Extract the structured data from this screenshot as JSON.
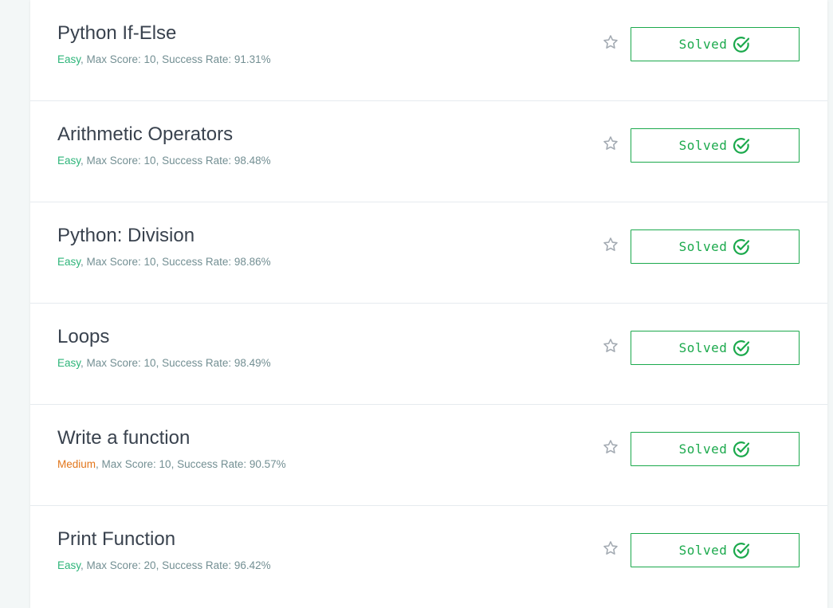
{
  "challenges": [
    {
      "title": "Python If-Else",
      "difficulty": "Easy",
      "difficulty_level": "easy",
      "meta": "Max Score: 10, Success Rate: 91.31%",
      "status": "Solved"
    },
    {
      "title": "Arithmetic Operators",
      "difficulty": "Easy",
      "difficulty_level": "easy",
      "meta": "Max Score: 10, Success Rate: 98.48%",
      "status": "Solved"
    },
    {
      "title": "Python: Division",
      "difficulty": "Easy",
      "difficulty_level": "easy",
      "meta": "Max Score: 10, Success Rate: 98.86%",
      "status": "Solved"
    },
    {
      "title": "Loops",
      "difficulty": "Easy",
      "difficulty_level": "easy",
      "meta": "Max Score: 10, Success Rate: 98.49%",
      "status": "Solved"
    },
    {
      "title": "Write a function",
      "difficulty": "Medium",
      "difficulty_level": "medium",
      "meta": "Max Score: 10, Success Rate: 90.57%",
      "status": "Solved"
    },
    {
      "title": "Print Function",
      "difficulty": "Easy",
      "difficulty_level": "easy",
      "meta": "Max Score: 20, Success Rate: 96.42%",
      "status": "Solved"
    }
  ],
  "colors": {
    "easy": "#2eb57a",
    "medium": "#e2761b",
    "solved": "#1ba94c",
    "title": "#39424e",
    "meta": "#738f93"
  },
  "icons": {
    "star": "star-icon",
    "check": "check-circle-icon"
  }
}
